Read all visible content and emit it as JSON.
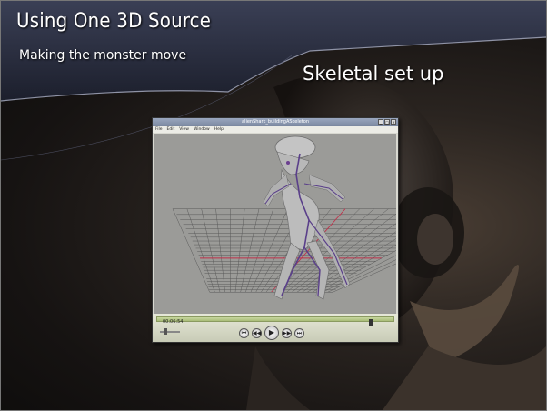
{
  "slide": {
    "title": "Using One 3D Source",
    "subtitle": "Making the monster move",
    "section_heading": "Skeletal set up"
  },
  "player": {
    "window_title": "alienShark_buildingASkeleton",
    "menu": [
      "File",
      "Edit",
      "View",
      "Window",
      "Help"
    ],
    "timecode": "00:06:54",
    "progress": 0.91,
    "volume": 0.2
  },
  "colors": {
    "grid_axis": "#c0304a",
    "grid_line": "#5a5a5a",
    "viewport_bg": "#9b9b98",
    "timebar": "#b4c788"
  }
}
